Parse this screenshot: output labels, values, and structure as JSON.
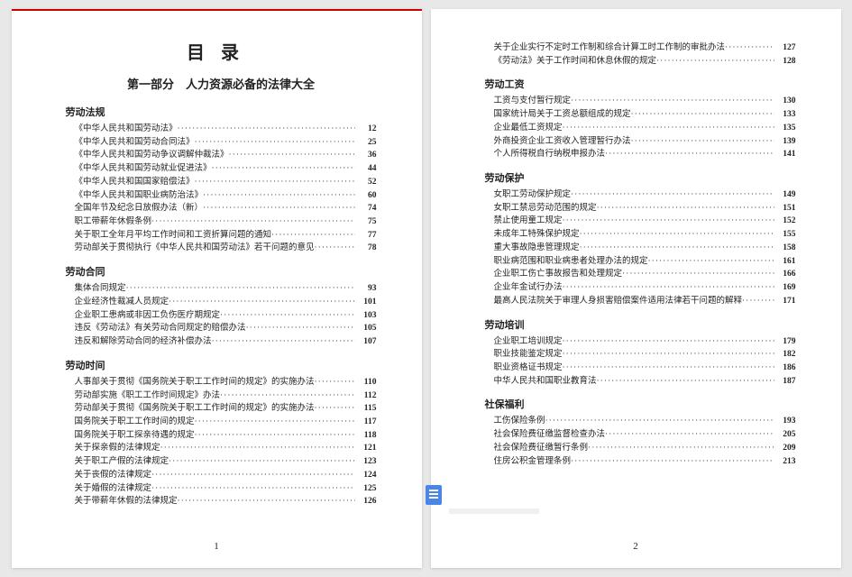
{
  "doc_title": "目录",
  "part_title": "第一部分　人力资源必备的法律大全",
  "page1_number": "1",
  "page2_number": "2",
  "sections_page1": [
    {
      "header": "劳动法规",
      "items": [
        {
          "label": "《中华人民共和国劳动法》",
          "page": "12"
        },
        {
          "label": "《中华人民共和国劳动合同法》",
          "page": "25"
        },
        {
          "label": "《中华人民共和国劳动争议调解仲裁法》",
          "page": "36"
        },
        {
          "label": "《中华人民共和国劳动就业促进法》",
          "page": "44"
        },
        {
          "label": "《中华人民共和国国家赔偿法》",
          "page": "52"
        },
        {
          "label": "《中华人民共和国职业病防治法》",
          "page": "60"
        },
        {
          "label": "全国年节及纪念日放假办法（新）",
          "page": "74"
        },
        {
          "label": "职工带薪年休假条例",
          "page": "75"
        },
        {
          "label": "关于职工全年月平均工作时间和工资折算问题的通知",
          "page": "77"
        },
        {
          "label": "劳动部关于贯彻执行《中华人民共和国劳动法》若干问题的意见",
          "page": "78"
        }
      ]
    },
    {
      "header": "劳动合同",
      "items": [
        {
          "label": "集体合同规定",
          "page": "93"
        },
        {
          "label": "企业经济性裁减人员规定",
          "page": "101"
        },
        {
          "label": "企业职工患病或非因工负伤医疗期规定",
          "page": "103"
        },
        {
          "label": "违反《劳动法》有关劳动合同规定的赔偿办法",
          "page": "105"
        },
        {
          "label": "违反和解除劳动合同的经济补偿办法",
          "page": "107"
        }
      ]
    },
    {
      "header": "劳动时间",
      "items": [
        {
          "label": "人事部关于贯彻《国务院关于职工工作时间的规定》的实施办法",
          "page": "110"
        },
        {
          "label": "劳动部实施《职工工作时间规定》办法",
          "page": "112"
        },
        {
          "label": "劳动部关于贯彻《国务院关于职工工作时间的规定》的实施办法",
          "page": "115"
        },
        {
          "label": "国务院关于职工工作时间的规定",
          "page": "117"
        },
        {
          "label": "国务院关于职工探亲待遇的规定",
          "page": "118"
        },
        {
          "label": "关于探亲假的法律规定",
          "page": "121"
        },
        {
          "label": "关于职工产假的法律规定",
          "page": "123"
        },
        {
          "label": "关于丧假的法律规定",
          "page": "124"
        },
        {
          "label": "关于婚假的法律规定",
          "page": "125"
        },
        {
          "label": "关于带薪年休假的法律规定",
          "page": "126"
        }
      ]
    }
  ],
  "sections_page2_pre": [
    {
      "label": "关于企业实行不定时工作制和综合计算工时工作制的审批办法",
      "page": "127"
    },
    {
      "label": "《劳动法》关于工作时间和休息休假的规定",
      "page": "128"
    }
  ],
  "sections_page2": [
    {
      "header": "劳动工资",
      "items": [
        {
          "label": "工资与支付暂行规定",
          "page": "130"
        },
        {
          "label": "国家统计局关于工资总额组成的规定",
          "page": "133"
        },
        {
          "label": "企业最低工资规定",
          "page": "135"
        },
        {
          "label": "外商投资企业工资收入管理暂行办法",
          "page": "139"
        },
        {
          "label": "个人所得税自行纳税申报办法",
          "page": "141"
        }
      ]
    },
    {
      "header": "劳动保护",
      "items": [
        {
          "label": "女职工劳动保护规定",
          "page": "149"
        },
        {
          "label": "女职工禁忌劳动范围的规定",
          "page": "151"
        },
        {
          "label": "禁止使用童工规定",
          "page": "152"
        },
        {
          "label": "未成年工特殊保护规定",
          "page": "155"
        },
        {
          "label": "重大事故隐患管理规定",
          "page": "158"
        },
        {
          "label": "职业病范围和职业病患者处理办法的规定",
          "page": "161"
        },
        {
          "label": "企业职工伤亡事故报告和处理规定",
          "page": "166"
        },
        {
          "label": "企业年金试行办法",
          "page": "169"
        },
        {
          "label": "最高人民法院关于审理人身损害赔偿案件适用法律若干问题的解释",
          "page": "171"
        }
      ]
    },
    {
      "header": "劳动培训",
      "items": [
        {
          "label": "企业职工培训规定",
          "page": "179"
        },
        {
          "label": "职业技能鉴定规定",
          "page": "182"
        },
        {
          "label": "职业资格证书规定",
          "page": "186"
        },
        {
          "label": "中华人民共和国职业教育法",
          "page": "187"
        }
      ]
    },
    {
      "header": "社保福利",
      "items": [
        {
          "label": "工伤保险条例",
          "page": "193"
        },
        {
          "label": "社会保险费征缴监督检查办法",
          "page": "205"
        },
        {
          "label": "社会保险费征缴暂行条例",
          "page": "209"
        },
        {
          "label": "住房公积金管理条例",
          "page": "213"
        }
      ]
    }
  ]
}
